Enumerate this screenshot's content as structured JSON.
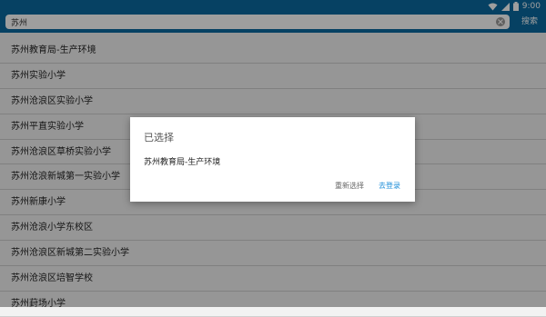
{
  "status_bar": {
    "time": "9:00"
  },
  "search": {
    "value": "苏州",
    "button_label": "搜索"
  },
  "list": {
    "items": [
      "苏州教育局-生产环境",
      "苏州实验小学",
      "苏州沧浪区实验小学",
      "苏州平直实验小学",
      "苏州沧浪区草桥实验小学",
      "苏州沧浪新城第一实验小学",
      "苏州新康小学",
      "苏州沧浪小学东校区",
      "苏州沧浪区新城第二实验小学",
      "苏州沧浪区培智学校",
      "苏州葑场小学"
    ]
  },
  "dialog": {
    "title": "已选择",
    "message": "苏州教育局-生产环境",
    "reselect_label": "重新选择",
    "login_label": "去登录"
  },
  "colors": {
    "accent": "#0a6aa1",
    "link": "#1a8cd8"
  }
}
